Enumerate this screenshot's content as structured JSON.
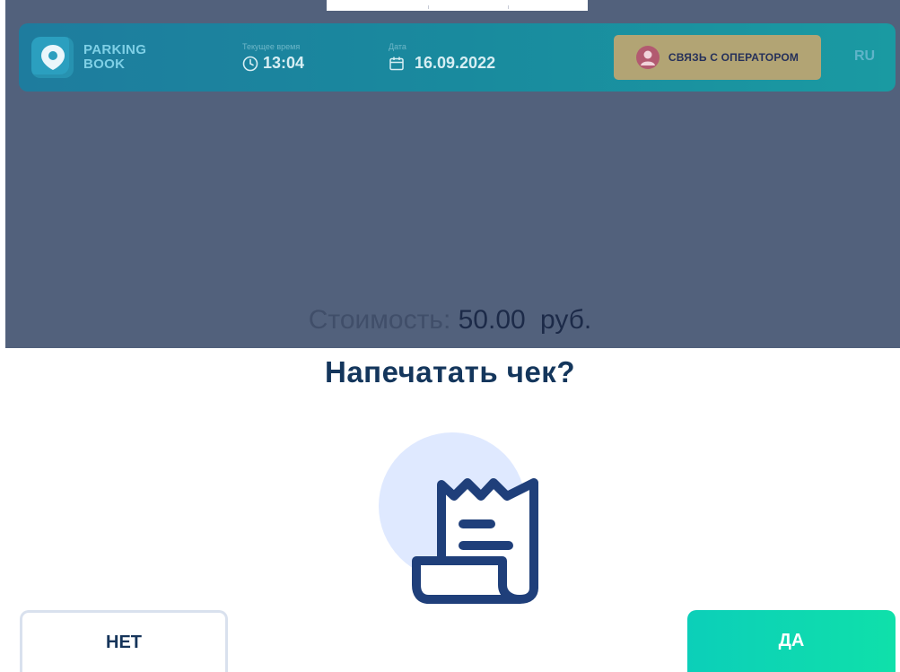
{
  "header": {
    "brand_line1": "PARKING",
    "brand_line2": "BOOK",
    "time_label": "Текущее время",
    "time_value": "13:04",
    "date_label": "Дата",
    "date_value": "16.09.2022",
    "operator_button": "СВЯЗЬ С ОПЕРАТОРОМ",
    "language": "RU"
  },
  "cost": {
    "label": "Стоимость:",
    "value": "50.00",
    "currency": "руб."
  },
  "dialog": {
    "question": "Напечатать чек?",
    "no_button": "НЕТ",
    "yes_button": "ДА"
  },
  "icons": {
    "logo": "map-pin-icon",
    "time": "clock-icon",
    "date": "calendar-icon",
    "operator": "operator-avatar-icon",
    "receipt": "receipt-icon"
  },
  "colors": {
    "overlay": "#52617c",
    "header": "#1a8aa0",
    "title": "#14365c",
    "yes_button": "#0fd9b0",
    "receipt_circle": "#dfe9ff",
    "receipt_stroke": "#1f3f7a"
  }
}
